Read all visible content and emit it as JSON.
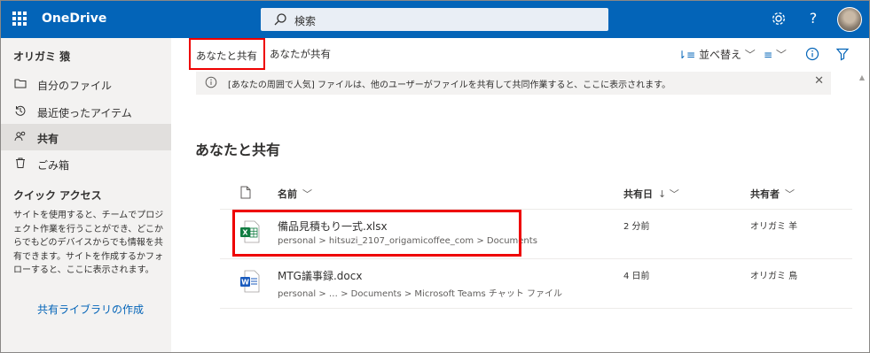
{
  "topbar": {
    "app_name": "OneDrive",
    "search_placeholder": "検索",
    "icons": [
      "waffle-icon",
      "search-icon",
      "gear-icon",
      "help-icon",
      "avatar"
    ]
  },
  "sidebar": {
    "user": "オリガミ 猿",
    "items": [
      {
        "label": "自分のファイル",
        "icon": "folder-icon"
      },
      {
        "label": "最近使ったアイテム",
        "icon": "history-icon"
      },
      {
        "label": "共有",
        "icon": "people-icon",
        "active": true
      },
      {
        "label": "ごみ箱",
        "icon": "trash-icon"
      }
    ],
    "quick_access": {
      "title": "クイック アクセス",
      "description": "サイトを使用すると、チームでプロジェクト作業を行うことができ、どこからでもどのデバイスからでも情報を共有できます。サイトを作成するかフォローすると、ここに表示されます。",
      "link": "共有ライブラリの作成"
    }
  },
  "main": {
    "tabs": {
      "shared_with_you": "あなたと共有",
      "shared_by_you": "あなたが共有"
    },
    "commands": {
      "sort": "並べ替え"
    },
    "banner": "[あなたの周囲で人気] ファイルは、他のユーザーがファイルを共有して共同作業すると、ここに表示されます。",
    "section_title": "あなたと共有",
    "columns": {
      "name": "名前",
      "shared_date": "共有日",
      "shared_by": "共有者"
    },
    "files": [
      {
        "name": "備品見積もり一式.xlsx",
        "path": "personal  >  hitsuzi_2107_origamicoffee_com  >  Documents",
        "date": "2 分前",
        "owner": "オリガミ 羊",
        "type": "excel"
      },
      {
        "name": "MTG議事録.docx",
        "path": "personal  >  …  >  Documents  >  Microsoft Teams チャット ファイル",
        "date": "4 日前",
        "owner": "オリガミ 鳥",
        "type": "word"
      }
    ]
  },
  "colors": {
    "brand": "#0364b8",
    "highlight": "#ee0000",
    "excel": "#107c41",
    "word": "#185abd"
  }
}
